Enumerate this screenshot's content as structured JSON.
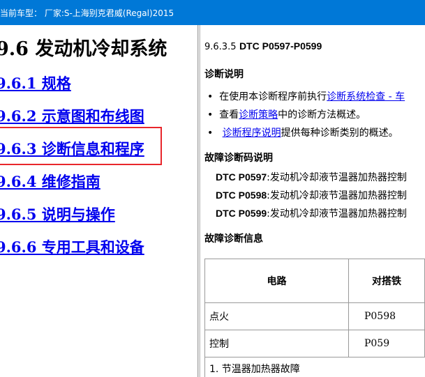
{
  "window": {
    "title": "当前车型：  厂家:S-上海别克君威(Regal)2015"
  },
  "left": {
    "heading": "9.6 发动机冷却系统",
    "links": [
      "9.6.1 规格",
      "9.6.2 示意图和布线图",
      "9.6.3 诊断信息和程序",
      "9.6.4 维修指南",
      "9.6.5 说明与操作",
      "9.6.6 专用工具和设备"
    ]
  },
  "right": {
    "section_number": "9.6.3.5",
    "section_title": "DTC P0597-P0599",
    "diag_heading": "诊断说明",
    "bullets": {
      "b1_prefix": "在使用本诊断程序前执行",
      "b1_link": "诊断系统检查 - 车",
      "b2_prefix": "查看",
      "b2_link": "诊断策略",
      "b2_suffix": "中的诊断方法概述。",
      "b3_link": "诊断程序说明",
      "b3_suffix": "提供每种诊断类别的概述。"
    },
    "dtc_heading": "故障诊断码说明",
    "dtcs": [
      {
        "code": "DTC P0597",
        "desc": ":发动机冷却液节温器加热器控制"
      },
      {
        "code": "DTC P0598",
        "desc": ":发动机冷却液节温器加热器控制"
      },
      {
        "code": "DTC P0599",
        "desc": ":发动机冷却液节温器加热器控制"
      }
    ],
    "info_heading": "故障诊断信息",
    "table": {
      "headers": [
        "电路",
        "对搭铁"
      ],
      "rows": [
        [
          "点火",
          "P0598"
        ],
        [
          "控制",
          "P059"
        ]
      ],
      "footnote": "1. 节温器加热器故障"
    }
  }
}
